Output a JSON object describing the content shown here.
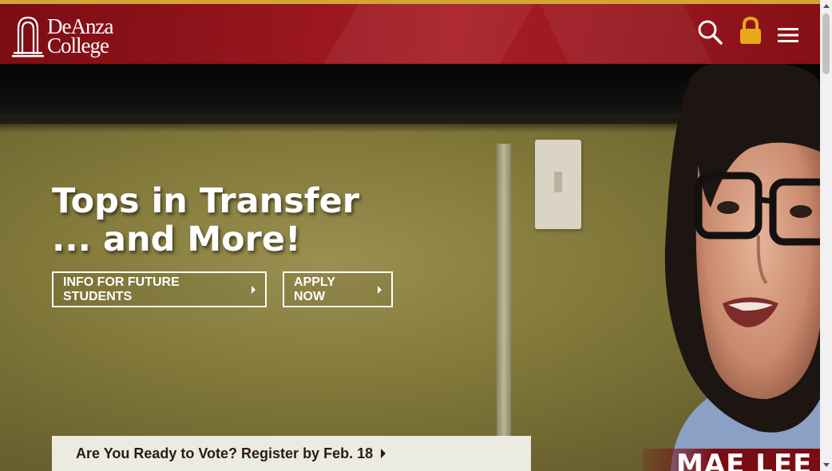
{
  "header": {
    "logo_line1": "DeAnza",
    "logo_line2": "College",
    "icons": [
      "search-icon",
      "lock-icon",
      "hamburger-menu-icon"
    ],
    "accent_color": "#d4a43a",
    "brand_color": "#9a1820"
  },
  "hero": {
    "headline_line1": "Tops in Transfer",
    "headline_line2": "... and More!",
    "cta_future_label": "INFO FOR FUTURE STUDENTS",
    "cta_apply_label": "APPLY NOW",
    "notice_label": "Are You Ready to Vote? Register by Feb. 18",
    "name_banner": "MAE LEE"
  }
}
